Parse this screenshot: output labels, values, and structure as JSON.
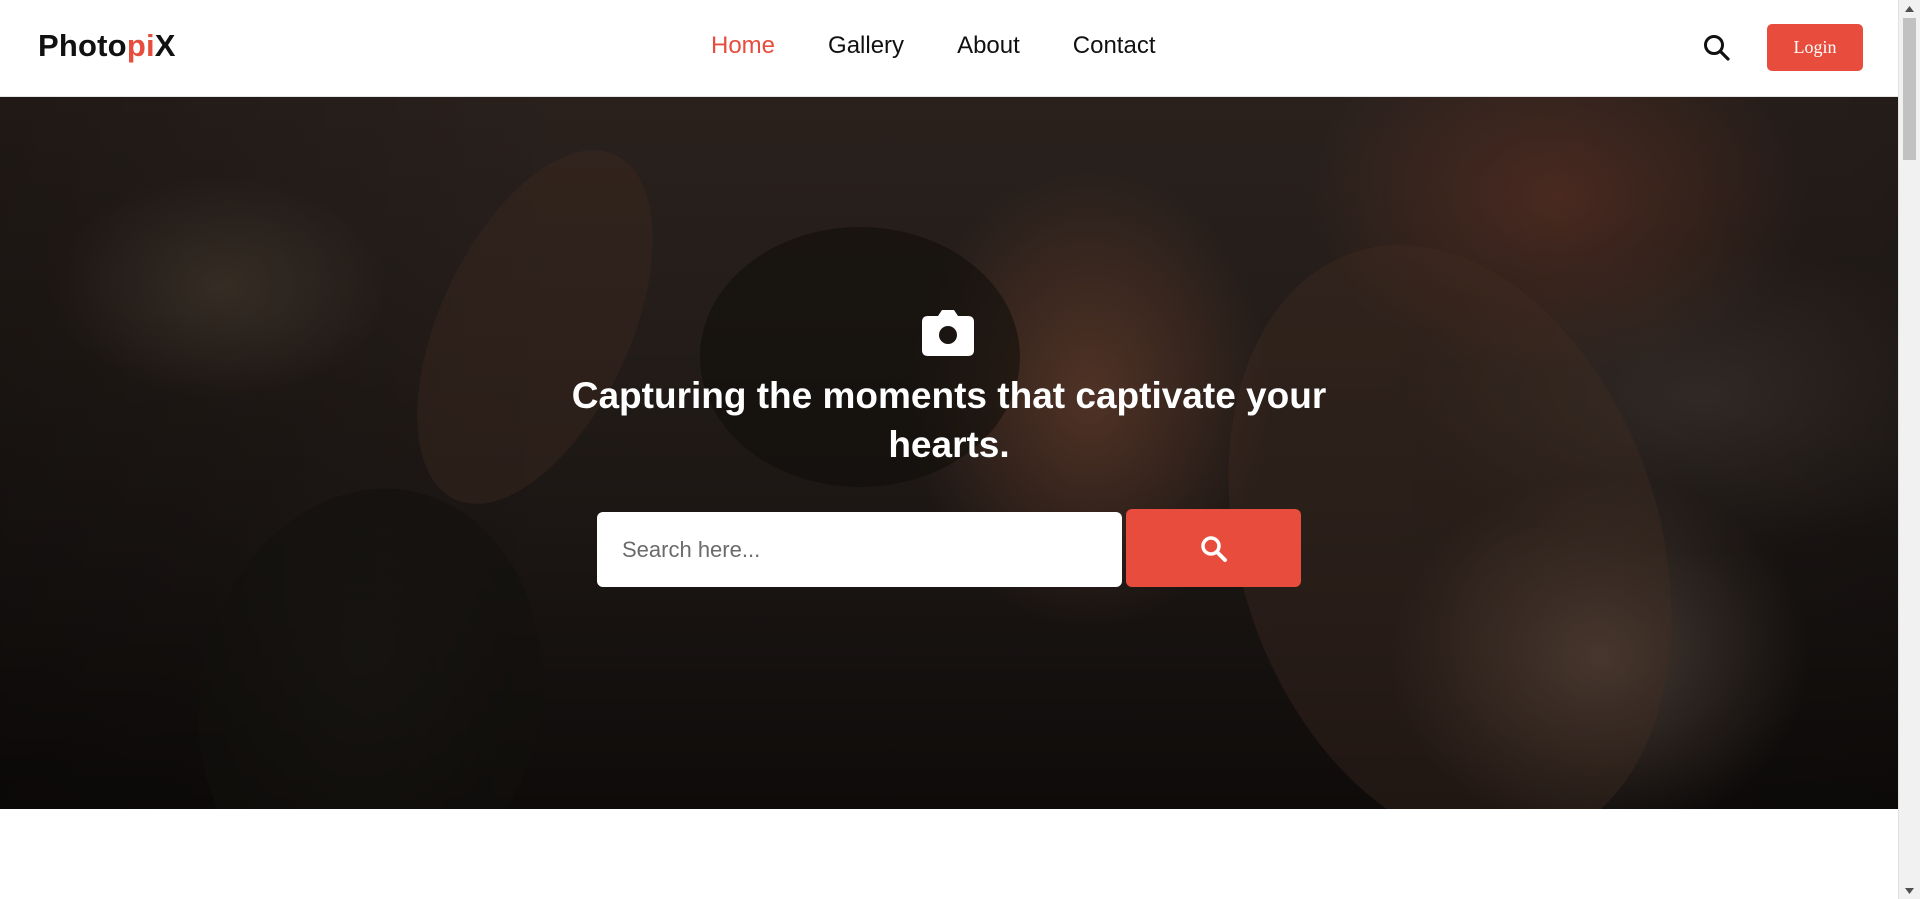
{
  "header": {
    "logo": {
      "part1": "Photo",
      "part2": "pi",
      "part3": "X"
    },
    "nav": [
      {
        "label": "Home",
        "active": true
      },
      {
        "label": "Gallery",
        "active": false
      },
      {
        "label": "About",
        "active": false
      },
      {
        "label": "Contact",
        "active": false
      }
    ],
    "search_icon": "search-icon",
    "login_label": "Login"
  },
  "hero": {
    "icon": "camera-icon",
    "title": "Capturing the moments that captivate your hearts.",
    "search": {
      "placeholder": "Search here...",
      "value": "",
      "button_icon": "search-icon"
    }
  },
  "colors": {
    "accent": "#e74c3c",
    "text": "#111111",
    "white": "#ffffff"
  }
}
